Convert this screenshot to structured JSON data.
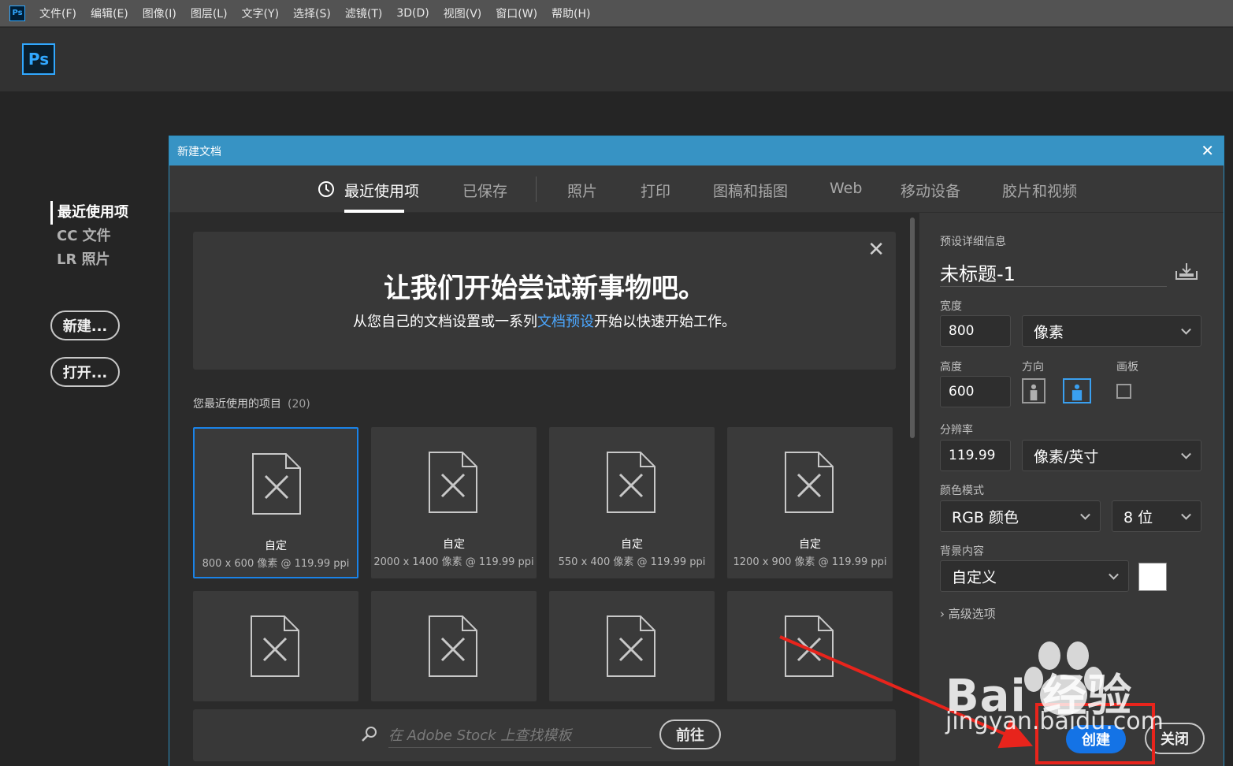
{
  "menubar": {
    "app_badge": "Ps",
    "items": [
      "文件(F)",
      "编辑(E)",
      "图像(I)",
      "图层(L)",
      "文字(Y)",
      "选择(S)",
      "滤镜(T)",
      "3D(D)",
      "视图(V)",
      "窗口(W)",
      "帮助(H)"
    ]
  },
  "app": {
    "logo": "Ps"
  },
  "leftnav": {
    "items": [
      "最近使用项",
      "CC 文件",
      "LR 照片"
    ],
    "new_button": "新建...",
    "open_button": "打开..."
  },
  "dialog": {
    "title": "新建文档",
    "close_glyph": "✕",
    "tabs": [
      "最近使用项",
      "已保存",
      "照片",
      "打印",
      "图稿和插图",
      "Web",
      "移动设备",
      "胶片和视频"
    ],
    "welcome": {
      "close_glyph": "✕",
      "title": "让我们开始尝试新事物吧。",
      "sub_before": "从您自己的文档设置或一系列",
      "sub_link": "文档预设",
      "sub_after": "开始以快速开始工作。"
    },
    "recent": {
      "heading": "您最近使用的项目",
      "count": "(20)",
      "cards": [
        {
          "name": "自定",
          "size": "800 x 600 像素 @ 119.99 ppi"
        },
        {
          "name": "自定",
          "size": "2000 x 1400 像素 @ 119.99 ppi"
        },
        {
          "name": "自定",
          "size": "550 x 400 像素 @ 119.99 ppi"
        },
        {
          "name": "自定",
          "size": "1200 x 900 像素 @ 119.99 ppi"
        }
      ]
    },
    "stock": {
      "placeholder": "在 Adobe Stock 上查找模板",
      "go_button": "前往"
    },
    "details": {
      "heading": "预设详细信息",
      "doc_name": "未标题-1",
      "width_label": "宽度",
      "width_value": "800",
      "width_unit": "像素",
      "height_label": "高度",
      "height_value": "600",
      "orientation_label": "方向",
      "artboard_label": "画板",
      "resolution_label": "分辨率",
      "resolution_value": "119.99",
      "resolution_unit": "像素/英寸",
      "color_mode_label": "颜色模式",
      "color_mode": "RGB 颜色",
      "bit_depth": "8 位",
      "background_label": "背景内容",
      "background": "自定义",
      "background_color": "#ffffff",
      "advanced": "高级选项",
      "create_button": "创建",
      "close_button": "关闭"
    }
  },
  "watermark": {
    "brand": "Bai  经验",
    "url": "jingyan.baidu.com"
  },
  "colors": {
    "accent": "#1473e6",
    "title_bar": "#3793c4",
    "annotation": "#e8241c"
  }
}
